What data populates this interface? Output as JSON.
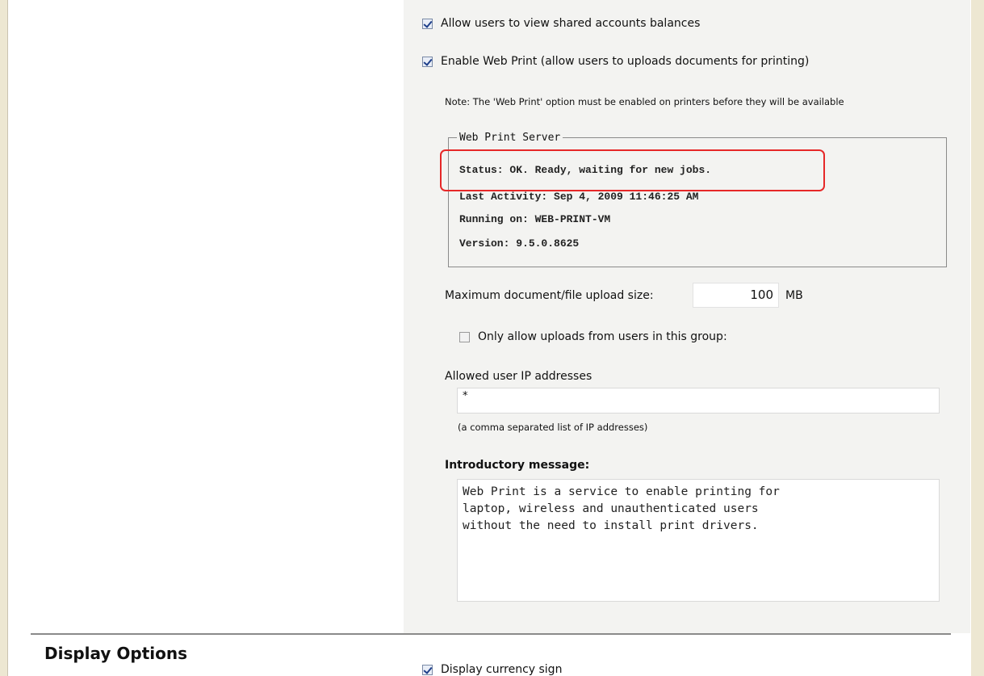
{
  "options": {
    "view_shared_balances": {
      "label": "Allow users to view shared accounts balances",
      "checked": true
    },
    "enable_web_print": {
      "label": "Enable Web Print (allow users to uploads documents for printing)",
      "checked": true
    },
    "note": "Note: The 'Web Print' option must be enabled on printers before they will be available"
  },
  "web_print_server": {
    "legend": "Web Print Server",
    "status": "Status: OK. Ready, waiting for new jobs.",
    "last_activity": "Last Activity: Sep 4, 2009 11:46:25 AM",
    "running_on": "Running on: WEB-PRINT-VM",
    "version": "Version: 9.5.0.8625"
  },
  "upload": {
    "max_size_label": "Maximum document/file upload size:",
    "max_size_value": "100",
    "max_size_unit": "MB",
    "only_group": {
      "label": "Only allow uploads from users in this group:",
      "checked": false
    }
  },
  "ip": {
    "label": "Allowed user IP addresses",
    "value": "*",
    "hint": "(a comma separated list of IP addresses)"
  },
  "intro": {
    "label": "Introductory message:",
    "text": "Web Print is a service to enable printing for\nlaptop, wireless and unauthenticated users\nwithout the need to install print drivers."
  },
  "display_options": {
    "title": "Display Options",
    "display_currency": {
      "label": "Display currency sign",
      "checked": true
    }
  },
  "colors": {
    "highlight": "#e62828",
    "panel_bg": "#f3f3f1"
  }
}
